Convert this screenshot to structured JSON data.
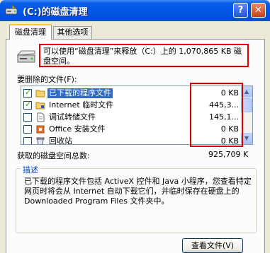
{
  "window": {
    "title": "(C:)的磁盘清理",
    "help_label": "?",
    "close_label": "✕"
  },
  "tabs": [
    {
      "label": "磁盘清理",
      "active": true
    },
    {
      "label": "其他选项",
      "active": false
    }
  ],
  "intro_text": "可以使用“磁盘清理”来释放（C:）上的 1,070,865 KB 磁盘空间。",
  "files_label": "要删除的文件(F):",
  "files": [
    {
      "name": "已下载的程序文件",
      "size": "0 KB",
      "checked": true,
      "selected": true
    },
    {
      "name": "Internet 临时文件",
      "size": "445,3...",
      "checked": true,
      "selected": false
    },
    {
      "name": "调试转储文件",
      "size": "145,1...",
      "checked": false,
      "selected": false
    },
    {
      "name": "Office 安装文件",
      "size": "0 KB",
      "checked": false,
      "selected": false
    },
    {
      "name": "回收站",
      "size": "0 KB",
      "checked": false,
      "selected": false
    }
  ],
  "total_label": "获取的磁盘空间总数:",
  "total_value": "925,709 K",
  "description_title": "描述",
  "description": "已下载的程序文件包括 ActiveX 控件和 Java 小程序，您查看特定网页时将会从 Internet 自动下载它们，并临时保存在硬盘上的 Downloaded Program Files 文件夹中。",
  "view_files_button": "查看文件(V)",
  "colors": {
    "titlebar": "#0055E5",
    "highlight": "#316AC5",
    "annotation": "#D80000"
  }
}
